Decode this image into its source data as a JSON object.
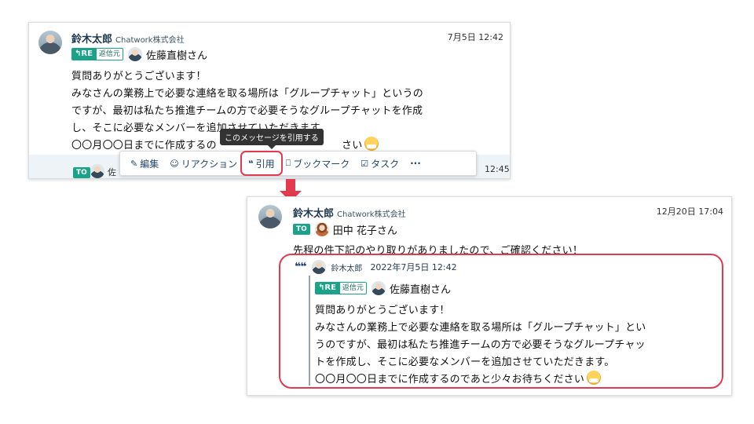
{
  "top_message": {
    "sender": "鈴木太郎",
    "org": "Chatwork株式会社",
    "time": "7月5日 12:42",
    "reply_badge": "RE",
    "reply_sub": "返信元",
    "reply_to": "佐藤直樹さん",
    "lines": [
      "質問ありがとうございます！",
      "みなさんの業務上で必要な連絡を取る場所は「グループチャット」というの",
      "ですが、最初は私たち推進チームの方で必要そうなグループチャットを作成",
      "し、そこに必要なメンバーを追加させていただきます。",
      "〇〇月〇〇日までに作成するの",
      "さい"
    ]
  },
  "tooltip": "このメッセージを引用する",
  "toolbar": {
    "items": [
      {
        "icon": "pencil-icon",
        "glyph": "✎",
        "label": "編集"
      },
      {
        "icon": "reaction-icon",
        "glyph": "☺",
        "label": "リアクション"
      },
      {
        "icon": "quote-icon",
        "glyph": "❝",
        "label": "引用"
      },
      {
        "icon": "bookmark-icon",
        "glyph": "⎕",
        "label": "ブックマーク"
      },
      {
        "icon": "task-icon",
        "glyph": "☑",
        "label": "タスク"
      },
      {
        "icon": "more-icon",
        "glyph": "",
        "label": "···"
      }
    ]
  },
  "next_message_peek": {
    "to_badge": "TO",
    "time_partial": "12:45",
    "name_partial": "佐"
  },
  "bottom_message": {
    "sender": "鈴木太郎",
    "org": "Chatwork株式会社",
    "time": "12月20日 17:04",
    "to_badge": "TO",
    "to_name": "田中 花子さん",
    "text": "先程の件下記のやり取りがありましたので、ご確認ください！",
    "quote": {
      "mark": "66",
      "sender": "鈴木太郎",
      "timestamp": "2022年7月5日 12:42",
      "reply_badge": "RE",
      "reply_sub": "返信元",
      "reply_to": "佐藤直樹さん",
      "lines": [
        "質問ありがとうございます！",
        "みなさんの業務上で必要な連絡を取る場所は「グループチャット」とい",
        "うのですが、最初は私たち推進チームの方で必要そうなグループチャッ",
        "トを作成し、そこに必要なメンバーを追加させていただきます。",
        "〇〇月〇〇日までに作成するのであと少々お待ちください"
      ]
    }
  },
  "colors": {
    "accent_red": "#e23a4e",
    "badge_green": "#1aa389",
    "link_blue": "#21476a"
  }
}
